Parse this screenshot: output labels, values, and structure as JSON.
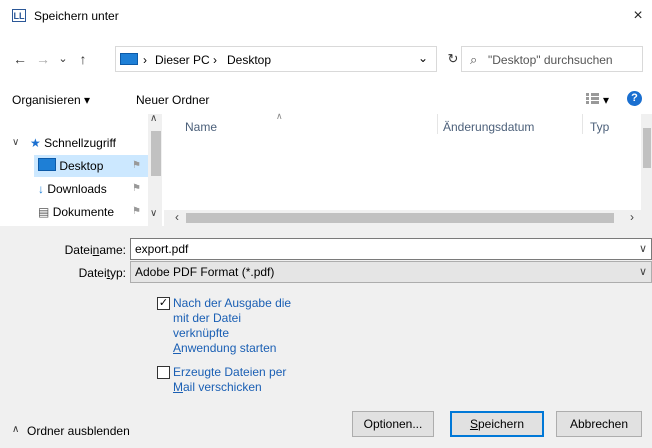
{
  "window": {
    "title": "Speichern unter",
    "app_icon_text": "LL",
    "close": "×"
  },
  "nav": {
    "back": "←",
    "forward": "→",
    "history": "⌄",
    "up": "↑"
  },
  "address": {
    "segments": [
      "Dieser PC",
      "Desktop"
    ],
    "sep": "›",
    "dropdown": "⌄"
  },
  "refresh": "↻",
  "search": {
    "placeholder": "\"Desktop\" durchsuchen"
  },
  "toolbar": {
    "organize": "Organisieren ▾",
    "new_folder": "Neuer Ordner",
    "view": "▾",
    "help": "?"
  },
  "sidebar": {
    "items": [
      {
        "label": "Schnellzugriff",
        "icon": "star-icon"
      },
      {
        "label": "Desktop",
        "icon": "desktop-icon",
        "selected": true
      },
      {
        "label": "Downloads",
        "icon": "download-icon"
      },
      {
        "label": "Dokumente",
        "icon": "document-icon"
      }
    ]
  },
  "columns": {
    "name": "Name",
    "date": "Änderungsdatum",
    "type": "Typ"
  },
  "form": {
    "filename_label_pre": "Datei",
    "filename_label_u": "n",
    "filename_label_post": "ame:",
    "filename_value": "export.pdf",
    "filetype_label_pre": "Datei",
    "filetype_label_u": "t",
    "filetype_label_post": "yp:",
    "filetype_value": "Adobe PDF Format (*.pdf)"
  },
  "options": {
    "open_after": {
      "lines": [
        "Nach der Ausgabe die",
        "mit der Datei",
        "verknüpfte"
      ],
      "last_u": "A",
      "last_rest": "nwendung starten",
      "checked": true
    },
    "send_mail": {
      "line1": "Erzeugte Dateien per",
      "line2_u": "M",
      "line2_rest": "ail verschicken",
      "checked": false
    }
  },
  "footer": {
    "hide_folders": "Ordner ausblenden",
    "options_btn": "Optionen...",
    "save_btn_u": "S",
    "save_btn_rest": "peichern",
    "cancel_btn": "Abbrechen"
  }
}
